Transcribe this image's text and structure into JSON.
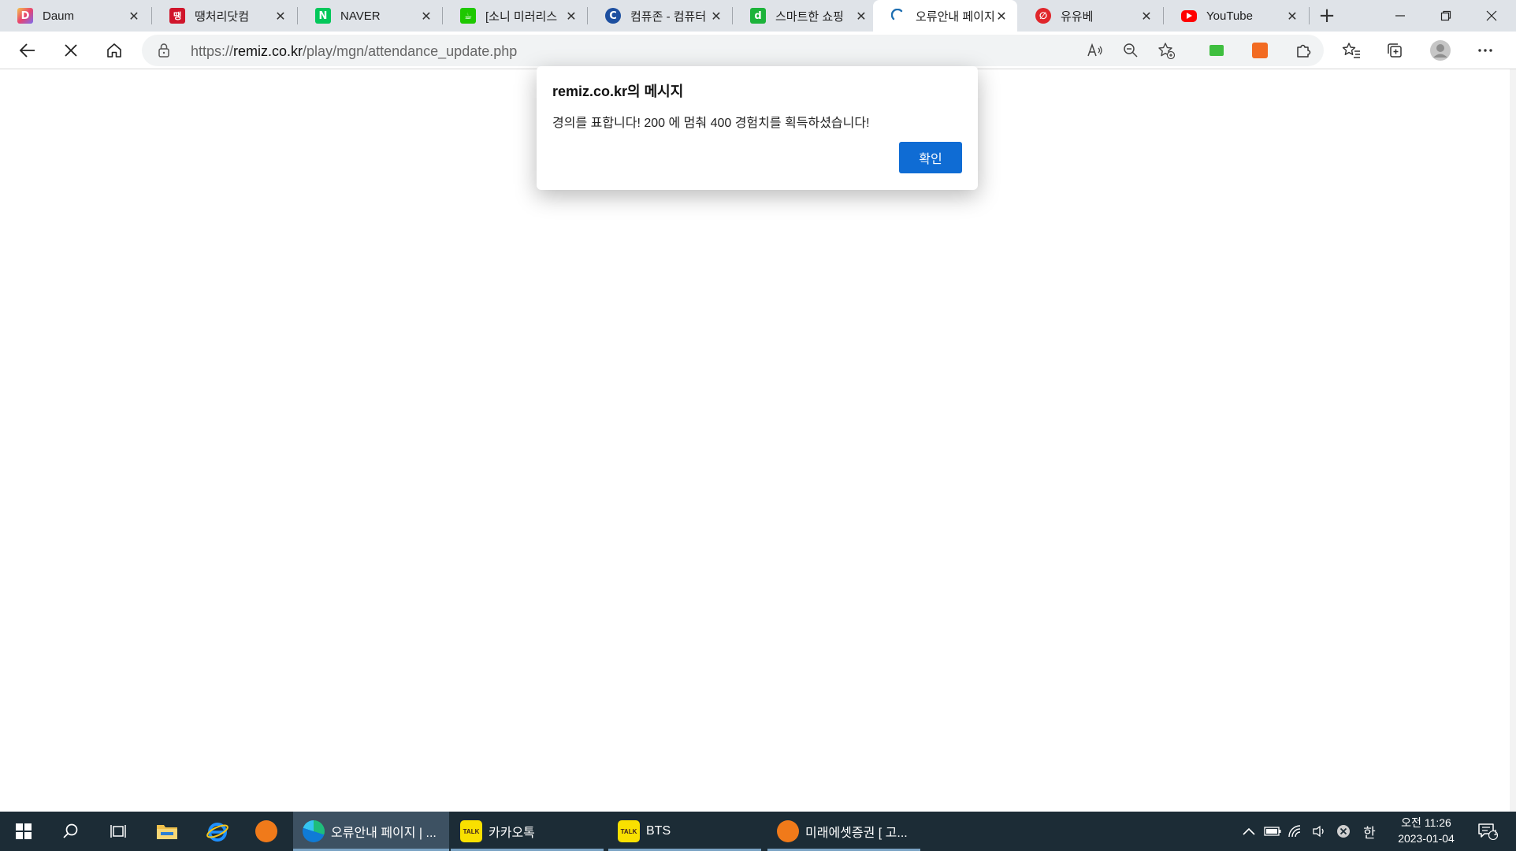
{
  "colors": {
    "accent": "#0f6cd4",
    "tabstrip_bg": "#dfe3e8",
    "taskbar_bg": "#1c2c36"
  },
  "tabs": [
    {
      "title": "Daum",
      "favicon": "daum-icon",
      "favicon_color": "#7b6cf0",
      "active": false
    },
    {
      "title": "땡처리닷컴",
      "favicon": "ttaengcheori-icon",
      "favicon_color": "#d0152b",
      "active": false
    },
    {
      "title": "NAVER",
      "favicon": "naver-icon",
      "favicon_color": "#03c75a",
      "active": false
    },
    {
      "title": "[소니 미러리스",
      "favicon": "cafe-icon",
      "favicon_color": "#1ec800",
      "active": false
    },
    {
      "title": "컴퓨존 - 컴퓨터",
      "favicon": "compuzone-icon",
      "favicon_color": "#1d4fa0",
      "active": false
    },
    {
      "title": "스마트한 쇼핑",
      "favicon": "danawa-icon",
      "favicon_color": "#1cb33a",
      "active": false
    },
    {
      "title": "오류안내 페이지",
      "favicon": "loading-spinner-icon",
      "favicon_color": "#1f6fb2",
      "active": true
    },
    {
      "title": "유유베",
      "favicon": "yuyube-icon",
      "favicon_color": "#e0262b",
      "active": false
    },
    {
      "title": "YouTube",
      "favicon": "youtube-icon",
      "favicon_color": "#ff0000",
      "active": false
    }
  ],
  "tab_close_glyph": "✕",
  "new_tab_glyph": "+",
  "address": {
    "scheme": "https://",
    "host": "remiz.co.kr",
    "path": "/play/mgn/attendance_update.php"
  },
  "dialog": {
    "title": "remiz.co.kr의 메시지",
    "message": "경의를 표합니다! 200 에 멈춰 400 경험치를 획득하셨습니다!",
    "ok_label": "확인"
  },
  "taskbar": {
    "apps": [
      {
        "label": "오류안내 페이지 | ...",
        "icon": "edge-icon",
        "active": true
      },
      {
        "label": "카카오톡",
        "icon": "kakaotalk-icon",
        "active": false
      },
      {
        "label": "BTS",
        "icon": "kakaotalk-icon",
        "active": false
      },
      {
        "label": "미래에셋증권 [ 고...",
        "icon": "mirae-asset-icon",
        "active": false
      }
    ],
    "ime_label": "한",
    "clock_ampm_time": "오전 11:26",
    "clock_date": "2023-01-04",
    "notification_count": "1",
    "kakao_icon_text": "TALK"
  }
}
